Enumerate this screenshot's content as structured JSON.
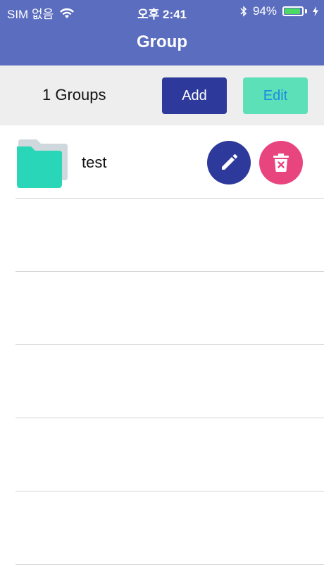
{
  "status_bar": {
    "carrier": "SIM 없음",
    "time": "오후 2:41",
    "battery_percent": "94%",
    "battery_level": 0.94,
    "icons": [
      "wifi-icon",
      "bluetooth-icon",
      "battery-icon",
      "charging-icon"
    ]
  },
  "header": {
    "title": "Group"
  },
  "toolbar": {
    "count_label": "1 Groups",
    "add_label": "Add",
    "edit_label": "Edit"
  },
  "groups": [
    {
      "name": "test",
      "icon": "folder-icon"
    }
  ],
  "colors": {
    "header": "#5b6dbf",
    "add_button": "#2e3a9b",
    "edit_button": "#5ce0b8",
    "edit_text": "#1a8de0",
    "row_edit": "#2e3a9b",
    "row_delete": "#e8457f",
    "folder": "#2ad6b8"
  }
}
